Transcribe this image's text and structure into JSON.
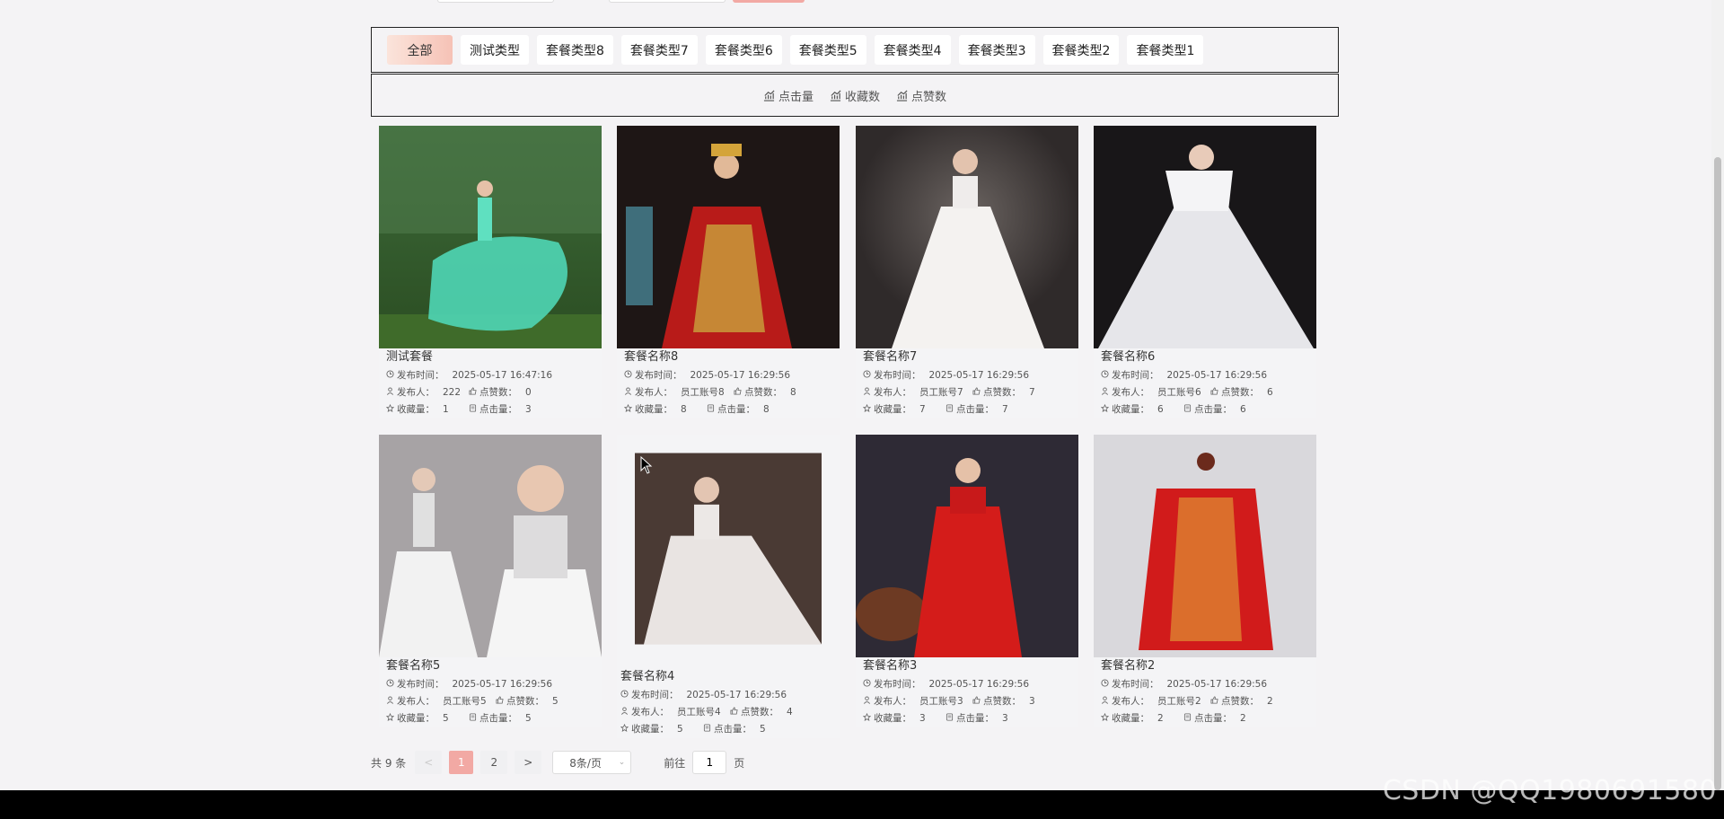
{
  "categories": [
    {
      "label": "全部",
      "active": true
    },
    {
      "label": "测试类型"
    },
    {
      "label": "套餐类型8"
    },
    {
      "label": "套餐类型7"
    },
    {
      "label": "套餐类型6"
    },
    {
      "label": "套餐类型5"
    },
    {
      "label": "套餐类型4"
    },
    {
      "label": "套餐类型3"
    },
    {
      "label": "套餐类型2"
    },
    {
      "label": "套餐类型1"
    }
  ],
  "sort": [
    {
      "label": "点击量",
      "icon": "chart-icon"
    },
    {
      "label": "收藏数",
      "icon": "chart-icon"
    },
    {
      "label": "点赞数",
      "icon": "chart-icon"
    }
  ],
  "labels": {
    "publish_time": "发布时间：",
    "publisher": "发布人：",
    "likes": "点赞数：",
    "favorites": "收藏量：",
    "clicks": "点击量："
  },
  "cards": [
    {
      "title": "测试套餐",
      "time": "2025-05-17 16:47:16",
      "publisher": "222",
      "likes": "0",
      "favorites": "1",
      "clicks": "3",
      "photo": "teal-gown"
    },
    {
      "title": "套餐名称8",
      "time": "2025-05-17 16:29:56",
      "publisher": "员工账号8",
      "likes": "8",
      "favorites": "8",
      "clicks": "8",
      "photo": "red-xiuhe"
    },
    {
      "title": "套餐名称7",
      "time": "2025-05-17 16:29:56",
      "publisher": "员工账号7",
      "likes": "7",
      "favorites": "7",
      "clicks": "7",
      "photo": "white-gown"
    },
    {
      "title": "套餐名称6",
      "time": "2025-05-17 16:29:56",
      "publisher": "员工账号6",
      "likes": "6",
      "favorites": "6",
      "clicks": "6",
      "photo": "white-gown-veil"
    },
    {
      "title": "套餐名称5",
      "time": "2025-05-17 16:29:56",
      "publisher": "员工账号5",
      "likes": "5",
      "favorites": "5",
      "clicks": "5",
      "photo": "jeweled-gown"
    },
    {
      "title": "套餐名称4",
      "time": "2025-05-17 16:29:56",
      "publisher": "员工账号4",
      "likes": "4",
      "favorites": "5",
      "clicks": "5",
      "photo": "lace-gown"
    },
    {
      "title": "套餐名称3",
      "time": "2025-05-17 16:29:56",
      "publisher": "员工账号3",
      "likes": "3",
      "favorites": "3",
      "clicks": "3",
      "photo": "red-qipao"
    },
    {
      "title": "套餐名称2",
      "time": "2025-05-17 16:29:56",
      "publisher": "员工账号2",
      "likes": "2",
      "favorites": "2",
      "clicks": "2",
      "photo": "red-mannequin"
    }
  ],
  "pagination": {
    "total": "共 9 条",
    "prev": "<",
    "pages": [
      "1",
      "2"
    ],
    "current": "1",
    "next": ">",
    "page_size": "8条/页",
    "goto_prefix": "前往",
    "goto_value": "1",
    "goto_suffix": "页"
  },
  "watermark": "CSDN @QQ1980691580",
  "colors": {
    "accent": "#f2a9a4",
    "page_bg": "#f4f3f5"
  }
}
